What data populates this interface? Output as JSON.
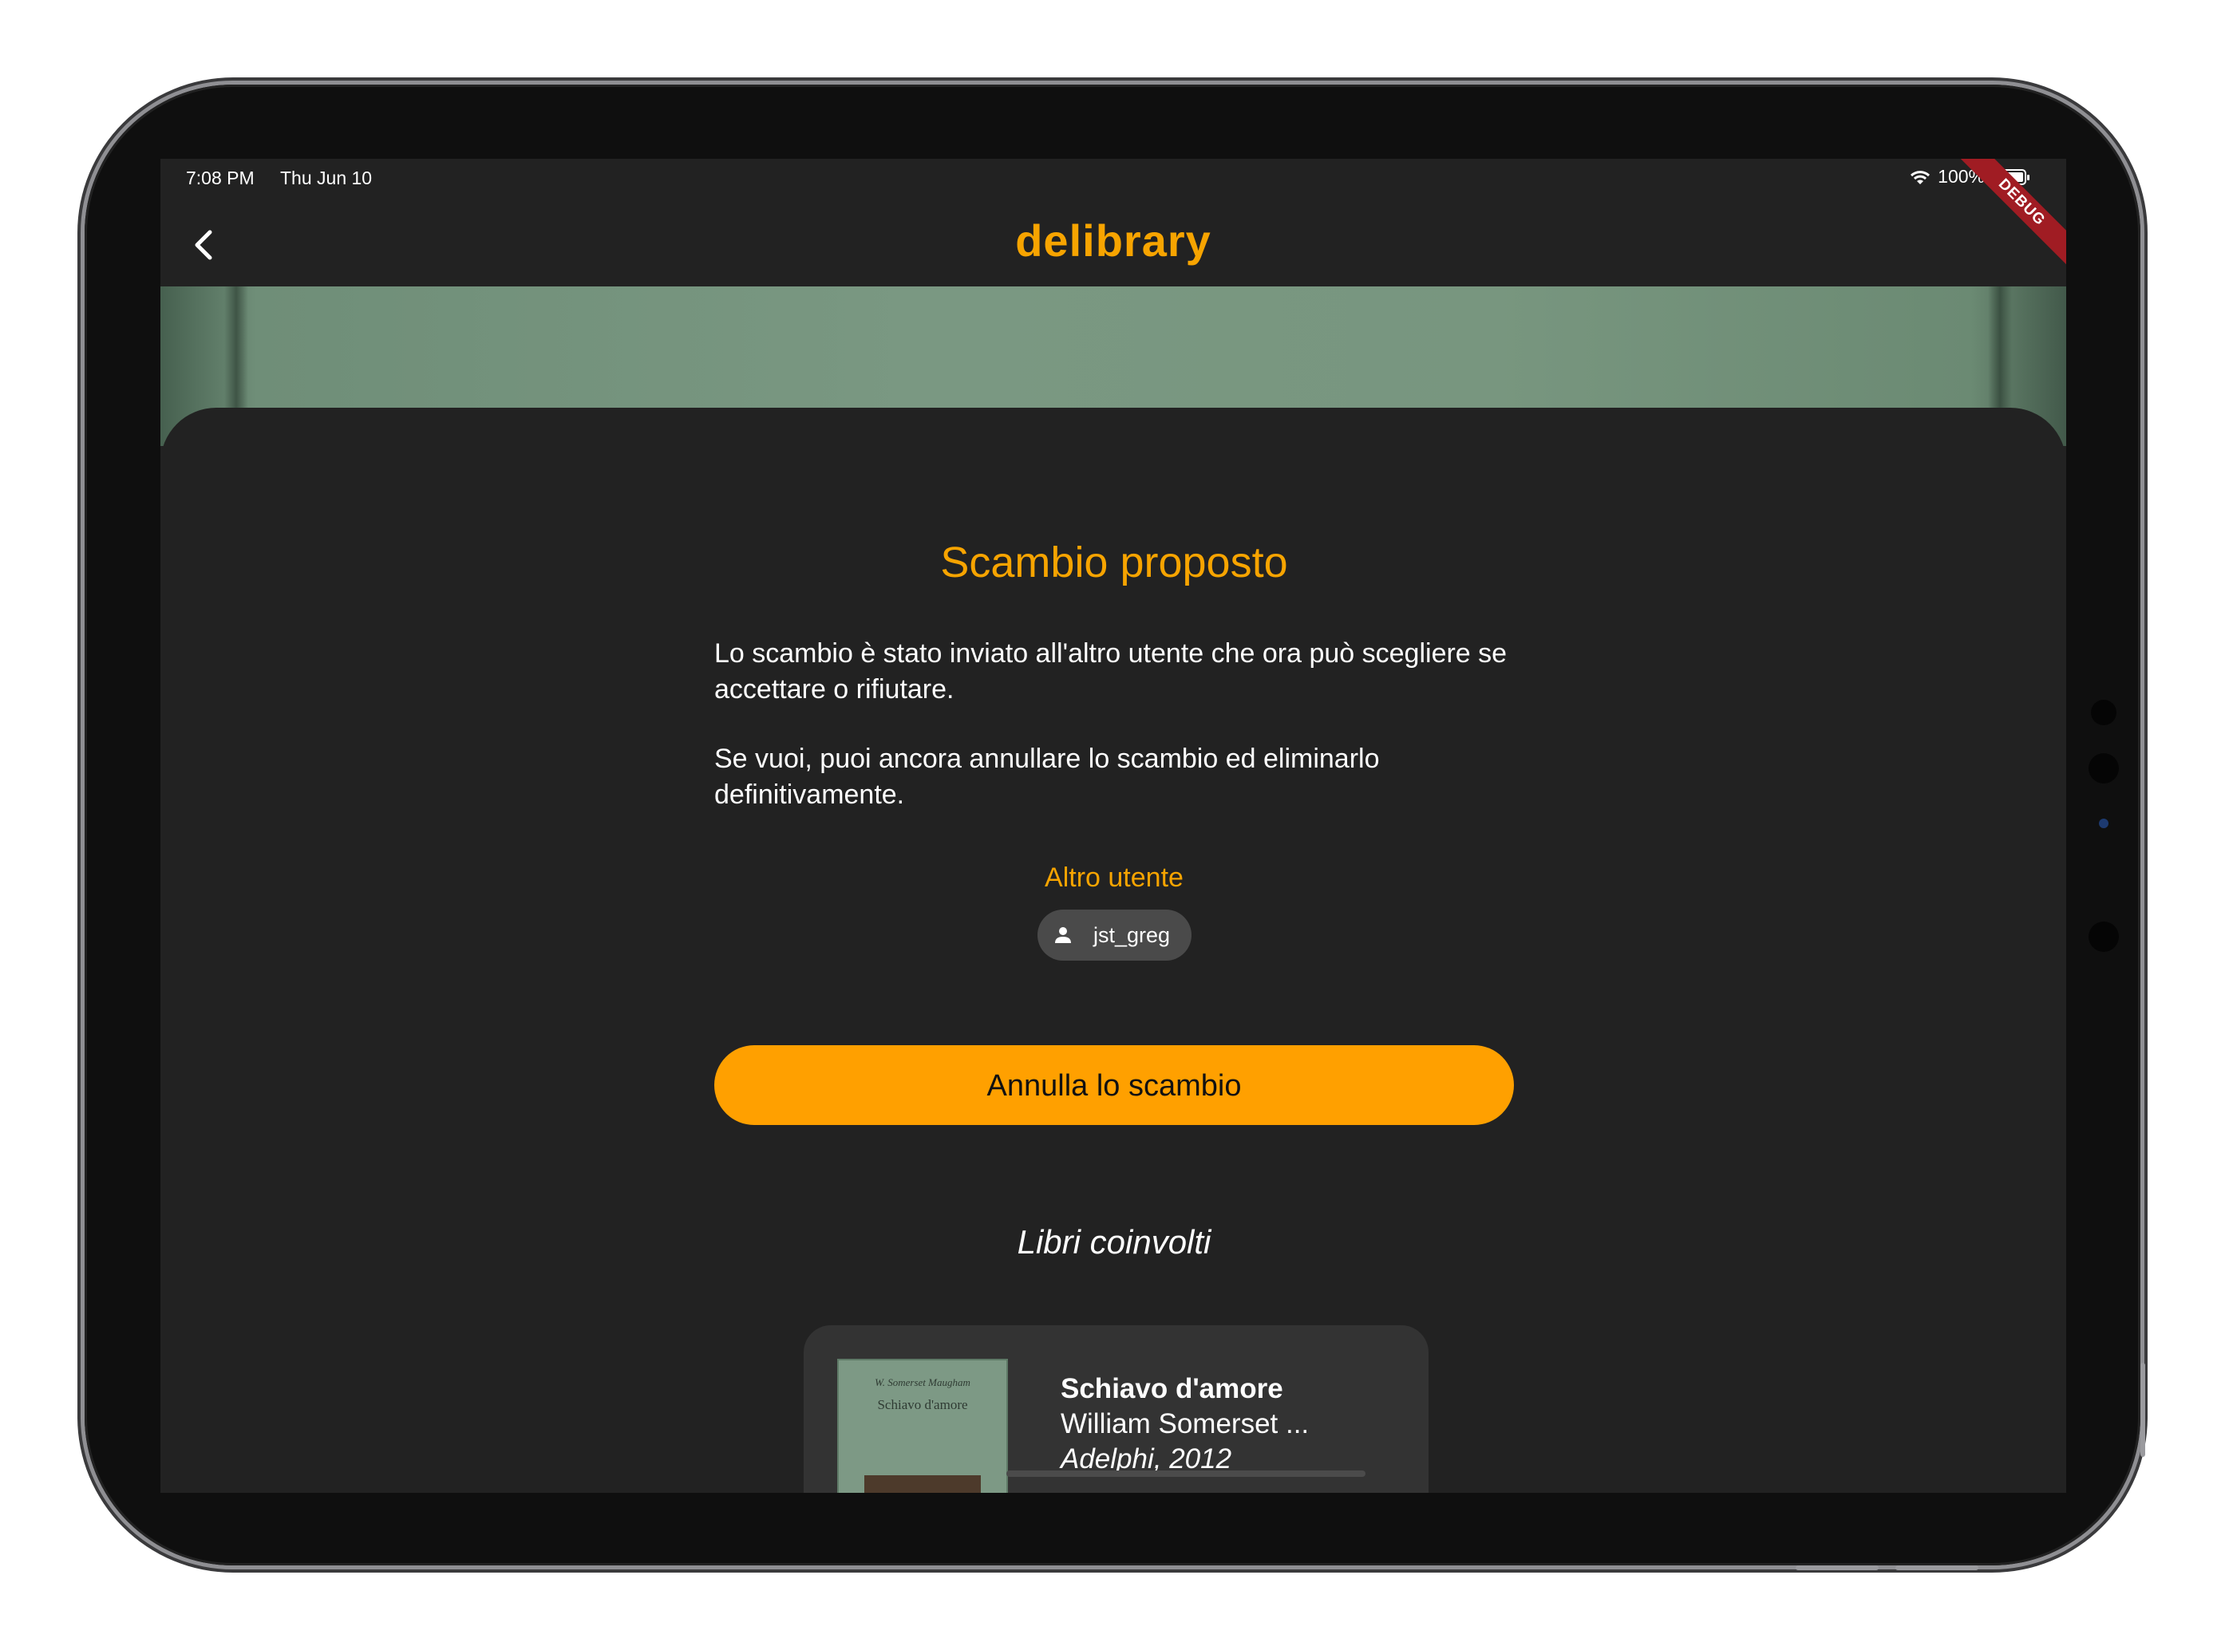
{
  "status_bar": {
    "time": "7:08 PM",
    "date": "Thu Jun 10",
    "battery": "100%",
    "debug_banner": "DEBUG"
  },
  "app_bar": {
    "title": "delibrary",
    "back_icon": "chevron-left-icon"
  },
  "exchange": {
    "title": "Scambio proposto",
    "description_1": "Lo scambio è stato inviato all'altro utente che ora può scegliere se accettare o rifiutare.",
    "description_2": "Se vuoi, puoi ancora annullare lo scambio ed eliminarlo definitivamente.",
    "other_user_label": "Altro utente",
    "other_user_name": "jst_greg",
    "cancel_button": "Annulla lo scambio",
    "books_heading": "Libri coinvolti"
  },
  "books": [
    {
      "title": "Schiavo d'amore",
      "author": "William Somerset ...",
      "publisher": "Adelphi, 2012",
      "cover_author": "W. Somerset Maugham",
      "cover_title": "Schiavo d'amore"
    }
  ],
  "colors": {
    "accent": "#f7a400",
    "button": "#ffa000",
    "background": "#222222",
    "card": "#333333"
  }
}
